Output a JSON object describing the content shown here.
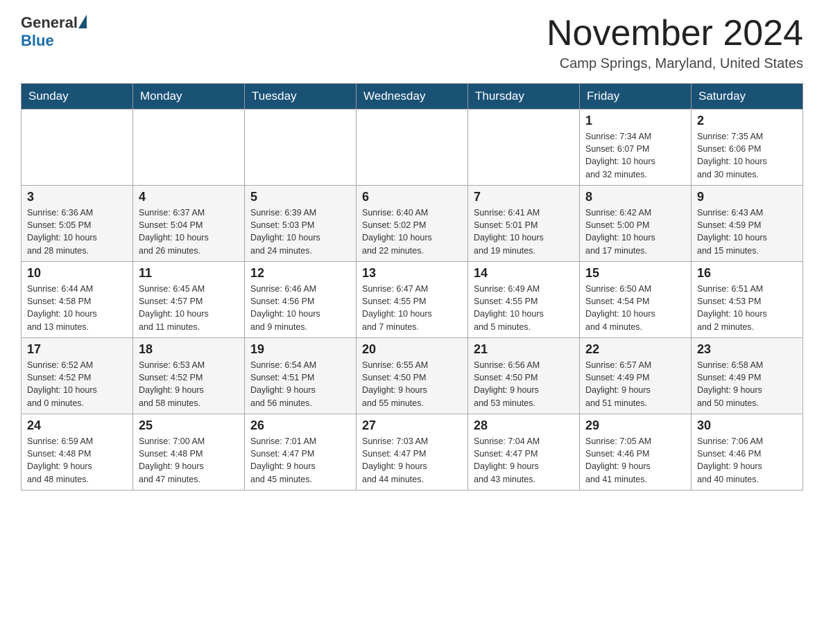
{
  "header": {
    "logo_general": "General",
    "logo_blue": "Blue",
    "month": "November 2024",
    "location": "Camp Springs, Maryland, United States"
  },
  "weekdays": [
    "Sunday",
    "Monday",
    "Tuesday",
    "Wednesday",
    "Thursday",
    "Friday",
    "Saturday"
  ],
  "weeks": [
    [
      {
        "day": "",
        "info": ""
      },
      {
        "day": "",
        "info": ""
      },
      {
        "day": "",
        "info": ""
      },
      {
        "day": "",
        "info": ""
      },
      {
        "day": "",
        "info": ""
      },
      {
        "day": "1",
        "info": "Sunrise: 7:34 AM\nSunset: 6:07 PM\nDaylight: 10 hours\nand 32 minutes."
      },
      {
        "day": "2",
        "info": "Sunrise: 7:35 AM\nSunset: 6:06 PM\nDaylight: 10 hours\nand 30 minutes."
      }
    ],
    [
      {
        "day": "3",
        "info": "Sunrise: 6:36 AM\nSunset: 5:05 PM\nDaylight: 10 hours\nand 28 minutes."
      },
      {
        "day": "4",
        "info": "Sunrise: 6:37 AM\nSunset: 5:04 PM\nDaylight: 10 hours\nand 26 minutes."
      },
      {
        "day": "5",
        "info": "Sunrise: 6:39 AM\nSunset: 5:03 PM\nDaylight: 10 hours\nand 24 minutes."
      },
      {
        "day": "6",
        "info": "Sunrise: 6:40 AM\nSunset: 5:02 PM\nDaylight: 10 hours\nand 22 minutes."
      },
      {
        "day": "7",
        "info": "Sunrise: 6:41 AM\nSunset: 5:01 PM\nDaylight: 10 hours\nand 19 minutes."
      },
      {
        "day": "8",
        "info": "Sunrise: 6:42 AM\nSunset: 5:00 PM\nDaylight: 10 hours\nand 17 minutes."
      },
      {
        "day": "9",
        "info": "Sunrise: 6:43 AM\nSunset: 4:59 PM\nDaylight: 10 hours\nand 15 minutes."
      }
    ],
    [
      {
        "day": "10",
        "info": "Sunrise: 6:44 AM\nSunset: 4:58 PM\nDaylight: 10 hours\nand 13 minutes."
      },
      {
        "day": "11",
        "info": "Sunrise: 6:45 AM\nSunset: 4:57 PM\nDaylight: 10 hours\nand 11 minutes."
      },
      {
        "day": "12",
        "info": "Sunrise: 6:46 AM\nSunset: 4:56 PM\nDaylight: 10 hours\nand 9 minutes."
      },
      {
        "day": "13",
        "info": "Sunrise: 6:47 AM\nSunset: 4:55 PM\nDaylight: 10 hours\nand 7 minutes."
      },
      {
        "day": "14",
        "info": "Sunrise: 6:49 AM\nSunset: 4:55 PM\nDaylight: 10 hours\nand 5 minutes."
      },
      {
        "day": "15",
        "info": "Sunrise: 6:50 AM\nSunset: 4:54 PM\nDaylight: 10 hours\nand 4 minutes."
      },
      {
        "day": "16",
        "info": "Sunrise: 6:51 AM\nSunset: 4:53 PM\nDaylight: 10 hours\nand 2 minutes."
      }
    ],
    [
      {
        "day": "17",
        "info": "Sunrise: 6:52 AM\nSunset: 4:52 PM\nDaylight: 10 hours\nand 0 minutes."
      },
      {
        "day": "18",
        "info": "Sunrise: 6:53 AM\nSunset: 4:52 PM\nDaylight: 9 hours\nand 58 minutes."
      },
      {
        "day": "19",
        "info": "Sunrise: 6:54 AM\nSunset: 4:51 PM\nDaylight: 9 hours\nand 56 minutes."
      },
      {
        "day": "20",
        "info": "Sunrise: 6:55 AM\nSunset: 4:50 PM\nDaylight: 9 hours\nand 55 minutes."
      },
      {
        "day": "21",
        "info": "Sunrise: 6:56 AM\nSunset: 4:50 PM\nDaylight: 9 hours\nand 53 minutes."
      },
      {
        "day": "22",
        "info": "Sunrise: 6:57 AM\nSunset: 4:49 PM\nDaylight: 9 hours\nand 51 minutes."
      },
      {
        "day": "23",
        "info": "Sunrise: 6:58 AM\nSunset: 4:49 PM\nDaylight: 9 hours\nand 50 minutes."
      }
    ],
    [
      {
        "day": "24",
        "info": "Sunrise: 6:59 AM\nSunset: 4:48 PM\nDaylight: 9 hours\nand 48 minutes."
      },
      {
        "day": "25",
        "info": "Sunrise: 7:00 AM\nSunset: 4:48 PM\nDaylight: 9 hours\nand 47 minutes."
      },
      {
        "day": "26",
        "info": "Sunrise: 7:01 AM\nSunset: 4:47 PM\nDaylight: 9 hours\nand 45 minutes."
      },
      {
        "day": "27",
        "info": "Sunrise: 7:03 AM\nSunset: 4:47 PM\nDaylight: 9 hours\nand 44 minutes."
      },
      {
        "day": "28",
        "info": "Sunrise: 7:04 AM\nSunset: 4:47 PM\nDaylight: 9 hours\nand 43 minutes."
      },
      {
        "day": "29",
        "info": "Sunrise: 7:05 AM\nSunset: 4:46 PM\nDaylight: 9 hours\nand 41 minutes."
      },
      {
        "day": "30",
        "info": "Sunrise: 7:06 AM\nSunset: 4:46 PM\nDaylight: 9 hours\nand 40 minutes."
      }
    ]
  ]
}
